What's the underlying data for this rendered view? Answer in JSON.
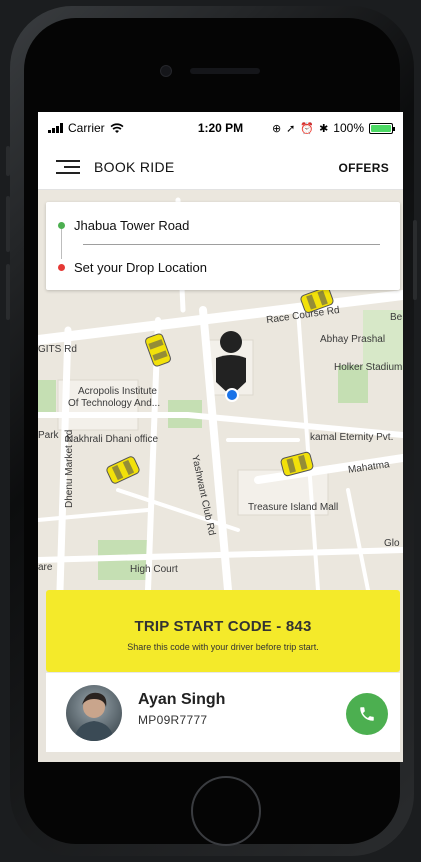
{
  "status_bar": {
    "carrier": "Carrier",
    "time": "1:20 PM",
    "battery": "100%",
    "battery_level": 1.0
  },
  "header": {
    "title": "BOOK RIDE",
    "offers_label": "OFFERS"
  },
  "locations": {
    "pickup": "Jhabua Tower Road",
    "drop_placeholder": "Set your Drop Location"
  },
  "map_labels": {
    "race_rd": "Race Course Rd",
    "abhay": "Abhay Prashal",
    "holker": "Holker Stadium",
    "gits": "GITS Rd",
    "acropolis_1": "Acropolis Institute",
    "acropolis_2": "Of Technology And...",
    "park": "Park",
    "nakhrali": "Nakhrali Dhani office",
    "yashwant": "Yashwant Club Rd",
    "kamal": "kamal Eternity Pvt.",
    "mahatma": "Mahatma",
    "dhenu": "Dhenu Market Rd",
    "treasure": "Treasure Island Mall",
    "high_court": "High Court",
    "glo": "Glo",
    "are": "are",
    "be": "Be"
  },
  "trip": {
    "title": "TRIP START CODE - 843",
    "subtitle": "Share this code with your driver before trip start."
  },
  "driver": {
    "name": "Ayan Singh",
    "plate": "MP09R7777"
  },
  "colors": {
    "accent_yellow": "#f4ea2a",
    "call_green": "#4caf50",
    "pickup_green": "#4caf50",
    "drop_red": "#e53935"
  },
  "icons": {
    "menu": "hamburger-icon",
    "call": "phone-icon",
    "pin": "person-pin-icon",
    "car": "taxi-icon"
  }
}
